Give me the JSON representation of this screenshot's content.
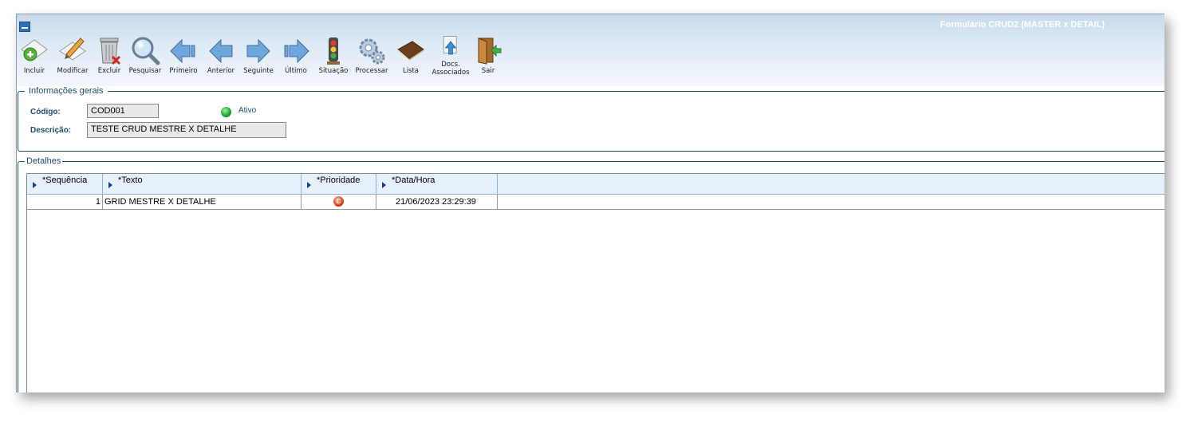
{
  "window": {
    "title": "Formulário CRUD2 (MASTER x DETAIL)"
  },
  "toolbar": {
    "buttons": [
      {
        "key": "incluir",
        "label": "Incluir",
        "icon": "add-document-icon"
      },
      {
        "key": "modificar",
        "label": "Modificar",
        "icon": "edit-pencil-icon"
      },
      {
        "key": "excluir",
        "label": "Excluir",
        "icon": "trash-delete-icon"
      },
      {
        "key": "pesquisar",
        "label": "Pesquisar",
        "icon": "magnifier-icon"
      },
      {
        "key": "primeiro",
        "label": "Primeiro",
        "icon": "first-arrow-icon"
      },
      {
        "key": "anterior",
        "label": "Anterior",
        "icon": "prev-arrow-icon"
      },
      {
        "key": "seguinte",
        "label": "Seguinte",
        "icon": "next-arrow-icon"
      },
      {
        "key": "ultimo",
        "label": "Último",
        "icon": "last-arrow-icon"
      },
      {
        "key": "situacao",
        "label": "Situação",
        "icon": "traffic-light-icon"
      },
      {
        "key": "processar",
        "label": "Processar",
        "icon": "gears-icon"
      },
      {
        "key": "lista",
        "label": "Lista",
        "icon": "book-icon"
      },
      {
        "key": "docs",
        "label_line1": "Docs.",
        "label_line2": "Associados",
        "icon": "upload-doc-icon"
      },
      {
        "key": "sair",
        "label": "Sair",
        "icon": "exit-door-icon"
      }
    ]
  },
  "info": {
    "legend": "Informações gerais",
    "codigo_label": "Código:",
    "codigo_value": "COD001",
    "status_text": "Ativo",
    "descricao_label": "Descrição:",
    "descricao_value": "TESTE CRUD MESTRE X DETALHE"
  },
  "detalhes": {
    "legend": "Detalhes",
    "columns": [
      "*Sequência",
      "*Texto",
      "*Prioridade",
      "*Data/Hora"
    ],
    "rows": [
      {
        "sequencia": "1",
        "texto": "GRID MESTRE X DETALHE",
        "prioridade": "C",
        "data_hora": "21/06/2023 23:29:39"
      }
    ]
  },
  "colors": {
    "title_bar": "#c8d9ec",
    "accent": "#1d4f6d",
    "status_active": "#19a83a",
    "priority": "#e1401b"
  }
}
